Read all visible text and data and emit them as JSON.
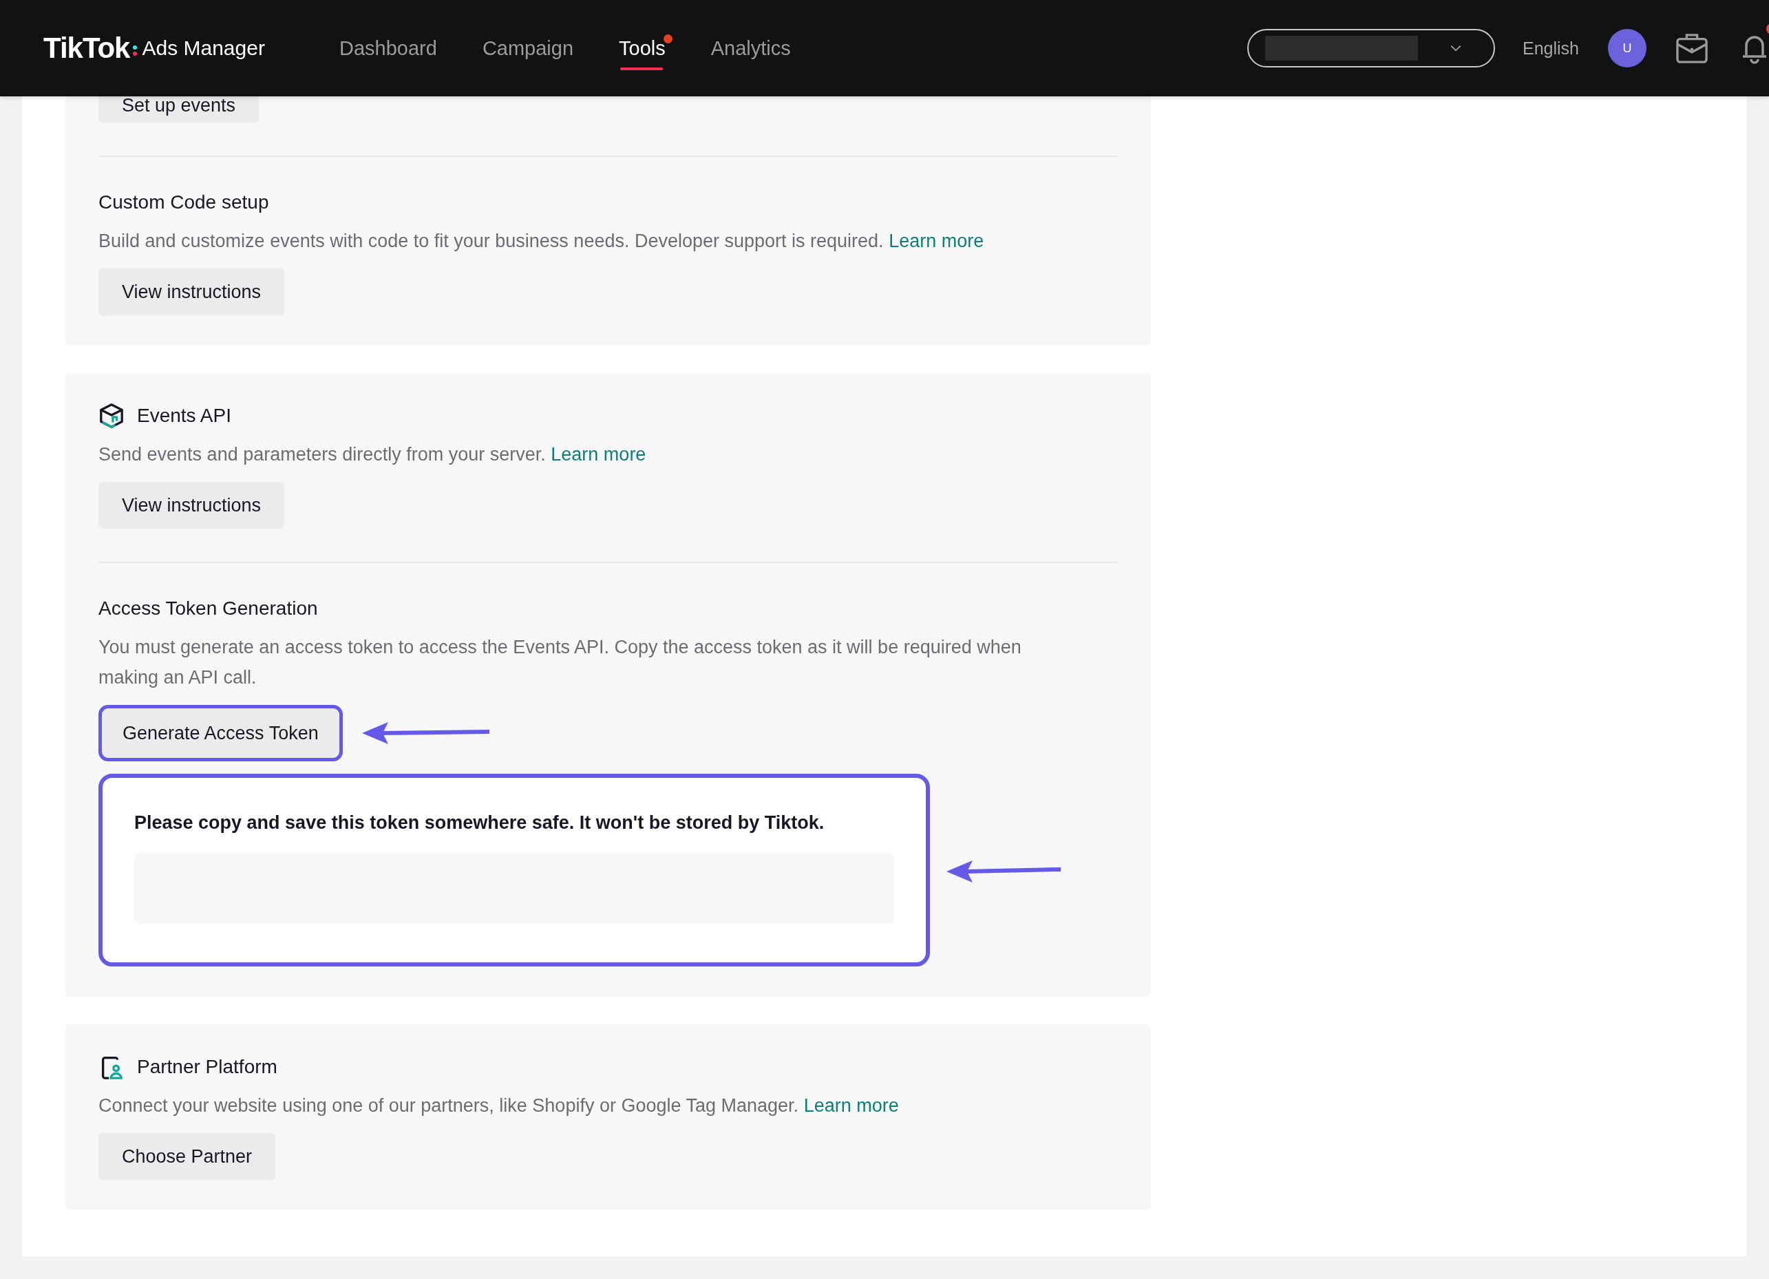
{
  "header": {
    "brand": "TikTok",
    "product": "Ads Manager",
    "nav": [
      {
        "label": "Dashboard",
        "selected": false,
        "badge": false
      },
      {
        "label": "Campaign",
        "selected": false,
        "badge": false
      },
      {
        "label": "Tools",
        "selected": true,
        "badge": true
      },
      {
        "label": "Analytics",
        "selected": false,
        "badge": false
      }
    ],
    "language": "English",
    "avatar": "U",
    "notification_badge": true
  },
  "cards": [
    {
      "blocks": [
        {
          "kind": "cutoff",
          "button": "Set up events"
        },
        {
          "kind": "plain",
          "title": "Custom Code setup",
          "description": "Build and customize events with code to fit your business needs. Developer support is required.",
          "link": "Learn more",
          "button": "View instructions"
        }
      ]
    },
    {
      "blocks": [
        {
          "kind": "cube",
          "title": "Events API",
          "description": "Send events and parameters directly from your server.",
          "link": "Learn more",
          "button": "View instructions"
        },
        {
          "kind": "token",
          "title": "Access Token Generation",
          "description": "You must generate an access token to access the Events API. Copy the access token as it will be required when making an API call.",
          "button": "Generate Access Token",
          "button_highlighted": true,
          "notice": "Please copy and save this token somewhere safe. It won't be stored by Tiktok.",
          "notice_highlighted": true
        }
      ]
    },
    {
      "blocks": [
        {
          "kind": "partner",
          "title": "Partner Platform",
          "description": "Connect your website using one of our partners, like Shopify or Google Tag Manager.",
          "link": "Learn more",
          "button": "Choose Partner"
        }
      ]
    }
  ]
}
